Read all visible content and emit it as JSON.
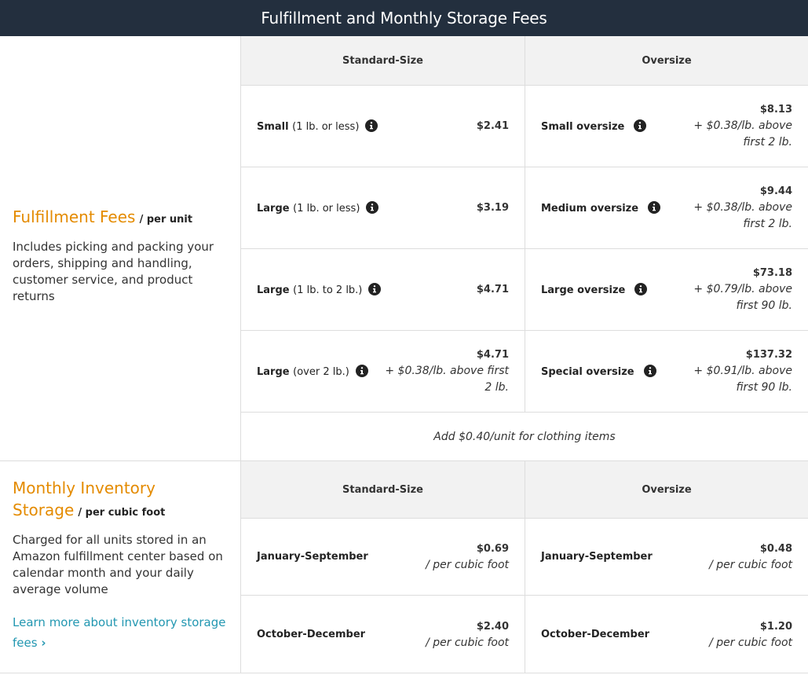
{
  "header": {
    "title": "Fulfillment and Monthly Storage Fees"
  },
  "fulfillment": {
    "title": "Fulfillment Fees",
    "unit": "/ per unit",
    "description": "Includes picking and packing your orders, shipping and handling, customer service, and product returns",
    "columns": {
      "standard": "Standard-Size",
      "oversize": "Oversize"
    },
    "standard_rows": [
      {
        "label": "Small",
        "sub": "(1 lb. or less)",
        "price": "$2.41",
        "extra": ""
      },
      {
        "label": "Large",
        "sub": "(1 lb. or less)",
        "price": "$3.19",
        "extra": ""
      },
      {
        "label": "Large",
        "sub": "(1 lb. to 2 lb.)",
        "price": "$4.71",
        "extra": ""
      },
      {
        "label": "Large",
        "sub": "(over 2 lb.)",
        "price": "$4.71",
        "extra": "+ $0.38/lb. above first 2 lb."
      }
    ],
    "oversize_rows": [
      {
        "label": "Small oversize",
        "price": "$8.13",
        "extra": "+ $0.38/lb. above first 2 lb."
      },
      {
        "label": "Medium oversize",
        "price": "$9.44",
        "extra": "+ $0.38/lb. above first 2 lb."
      },
      {
        "label": "Large oversize",
        "price": "$73.18",
        "extra": "+ $0.79/lb. above first 90 lb."
      },
      {
        "label": "Special oversize",
        "price": "$137.32",
        "extra": "+ $0.91/lb. above first 90 lb."
      }
    ],
    "note": "Add $0.40/unit for clothing items"
  },
  "storage": {
    "title": "Monthly Inventory Storage",
    "unit": "/ per cubic foot",
    "description": "Charged for all units stored in an Amazon fulfillment center based on calendar month and your daily average volume",
    "link_text": "Learn more about inventory storage fees",
    "link_chevron": "›",
    "columns": {
      "standard": "Standard-Size",
      "oversize": "Oversize"
    },
    "standard_rows": [
      {
        "label": "January-September",
        "price": "$0.69",
        "extra": "/ per cubic foot"
      },
      {
        "label": "October-December",
        "price": "$2.40",
        "extra": "/ per cubic foot"
      }
    ],
    "oversize_rows": [
      {
        "label": "January-September",
        "price": "$0.48",
        "extra": "/ per cubic foot"
      },
      {
        "label": "October-December",
        "price": "$1.20",
        "extra": "/ per cubic foot"
      }
    ]
  },
  "icons": {
    "info": "info-circle-icon"
  },
  "colors": {
    "header_bg": "#232f3e",
    "accent_orange": "#e48b00",
    "link_teal": "#2297b1",
    "table_head_bg": "#f2f2f2"
  }
}
